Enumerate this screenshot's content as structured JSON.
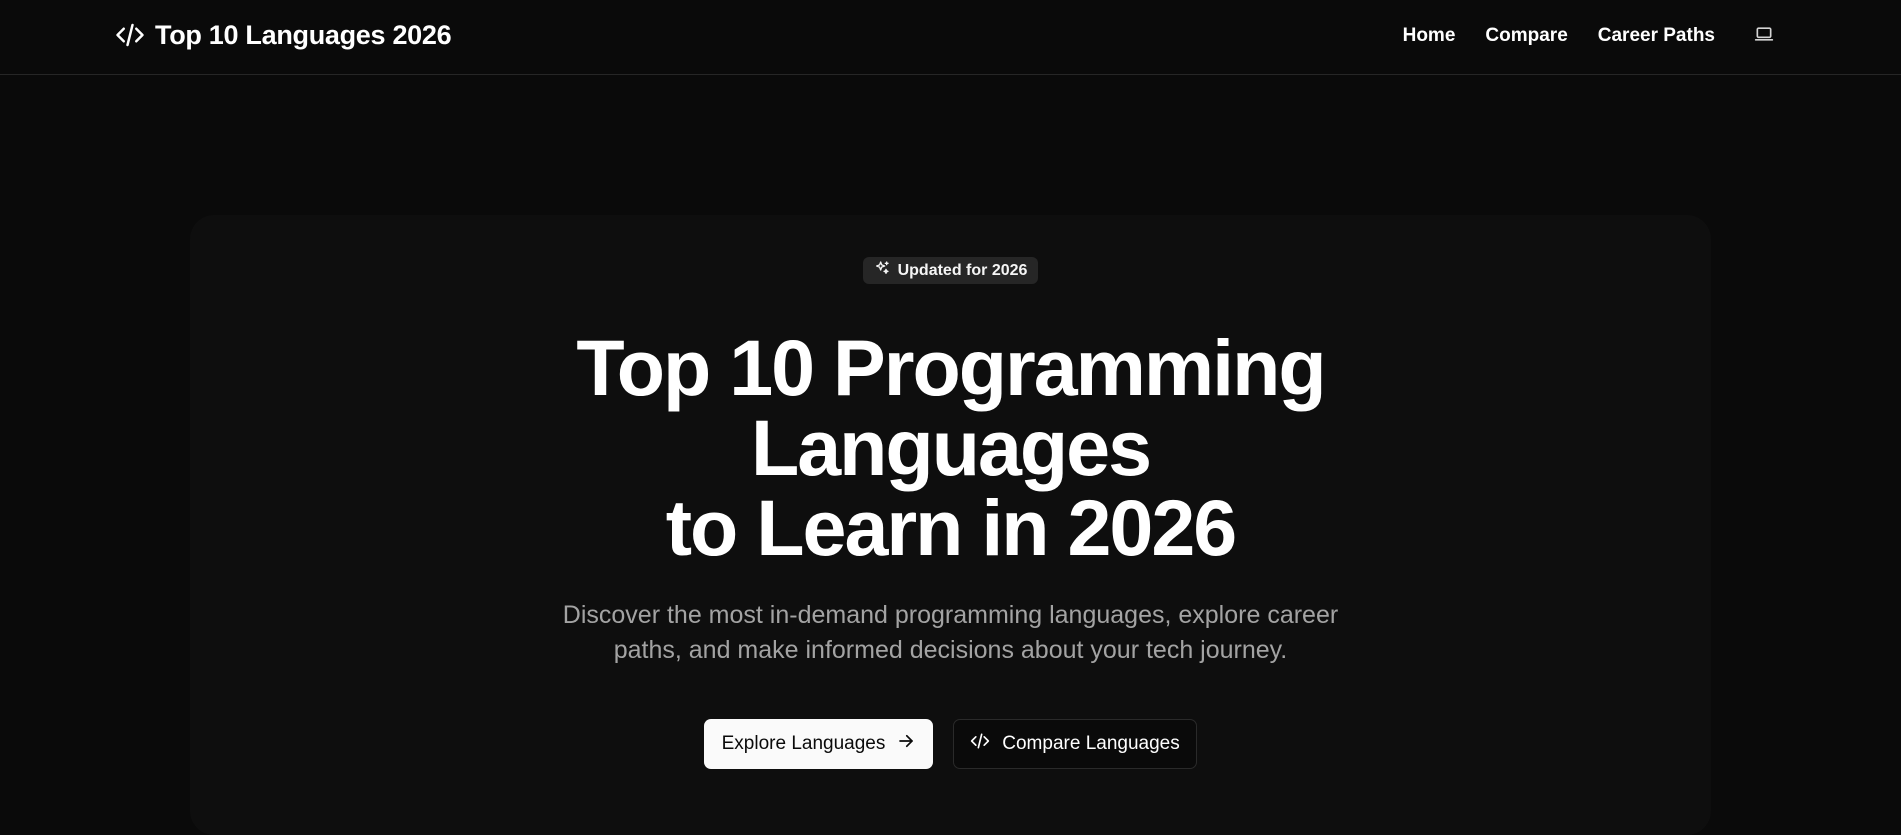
{
  "header": {
    "brand_icon": "code-icon",
    "brand_title": "Top 10 Languages 2026",
    "nav": [
      {
        "label": "Home"
      },
      {
        "label": "Compare"
      },
      {
        "label": "Career Paths"
      }
    ],
    "theme_toggle_icon": "laptop-icon"
  },
  "hero": {
    "badge": {
      "icon": "sparkles-icon",
      "label": "Updated for 2026"
    },
    "title_lines": [
      "Top 10 Programming",
      "Languages",
      "to Learn in 2026"
    ],
    "subtitle_lines": [
      "Discover the most in-demand programming languages, explore career",
      "paths, and make informed decisions about your tech journey."
    ],
    "primary_button": {
      "label": "Explore Languages",
      "icon": "arrow-right-icon"
    },
    "secondary_button": {
      "label": "Compare Languages",
      "icon": "code-icon"
    }
  },
  "colors": {
    "background": "#0a0a0a",
    "text": "#ffffff",
    "muted_text": "#a3a3a3",
    "badge_bg": "#262626",
    "primary_button_bg": "#fafafa",
    "border": "#262626"
  }
}
